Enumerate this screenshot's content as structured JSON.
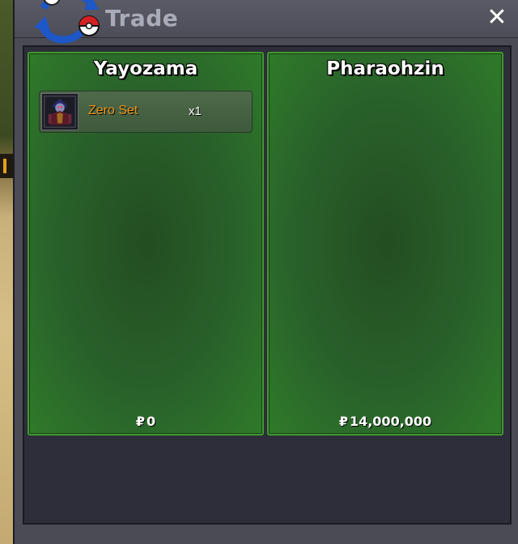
{
  "window": {
    "title": "Trade",
    "close_icon": "close-icon",
    "logo_icon": "pokeball-arrows-icon"
  },
  "left_panel": {
    "player_name": "Yayozama",
    "items": [
      {
        "name": "Zero Set",
        "quantity": "x1",
        "icon": "zero-set-outfit-icon"
      }
    ],
    "currency_symbol": "₽",
    "money": "0"
  },
  "right_panel": {
    "player_name": "Pharaohzin",
    "items": [],
    "currency_symbol": "₽",
    "money": "14,000,000"
  },
  "colors": {
    "panel_green": "#2f7a2a",
    "item_name": "#f0961e",
    "title": "#a9acb8"
  }
}
